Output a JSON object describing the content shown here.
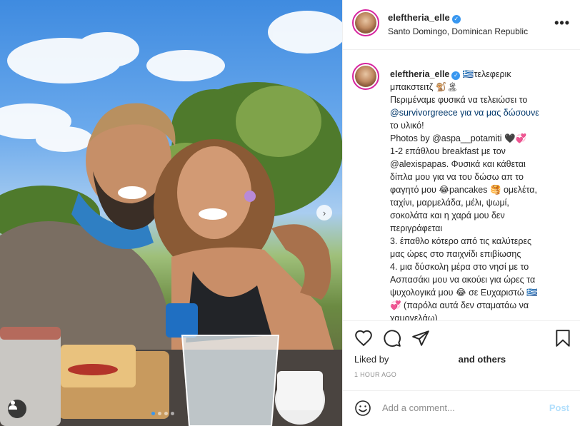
{
  "post": {
    "username": "eleftheria_elle",
    "location": "Santo Domingo, Dominican Republic",
    "more_label": "•••"
  },
  "caption": {
    "username": "eleftheria_elle",
    "lines": [
      "🇬🇷τελεφερικ",
      "μπακστειτζ 🐒🏝",
      "Περιμέναμε φυσικά να τελειώσει το",
      "@survivorgreece για να μας δώσουνε",
      "το υλικό!",
      "Photos by @aspa__potamiti 🖤💞",
      "1-2 επάθλου breakfast με τον",
      "@alexispapas. Φυσικά και κάθεται",
      "δίπλα μου για να του δώσω απ το",
      "φαγητό μου 😂pancakes 🥞 ομελέτα,",
      "ταχίνι, μαρμελάδα, μέλι, ψωμί,",
      "σοκολάτα και η χαρά μου δεν",
      "περιγράφεται",
      "3. έπαθλο κότερο από τις καλύτερες",
      "μας ώρες στο παιχνίδι επιβίωσης",
      "4. μια δύσκολη μέρα στο νησί με το",
      "Ασπασάκι μου να ακούει για ώρες τα",
      "ψυχολογικά μου 😂 σε Ευχαριστώ 🇬🇷",
      "💞 (παρόλα αυτά δεν σταματάω να",
      "χαμογελάω)"
    ]
  },
  "likes": {
    "prefix": "Liked by",
    "suffix": "and others"
  },
  "timestamp": "1 HOUR AGO",
  "comment": {
    "placeholder": "Add a comment...",
    "post_label": "Post"
  },
  "icons": {
    "like": "heart-icon",
    "comment": "comment-icon",
    "share": "share-icon",
    "save": "bookmark-icon",
    "emoji": "emoji-icon",
    "carousel_next": "chevron-right-icon",
    "tag": "user-tag-icon"
  },
  "colors": {
    "accent": "#3897f0",
    "mention": "#00376b",
    "post_disabled": "#b2dffc",
    "muted": "#8e8e8e"
  },
  "carousel": {
    "slide_count": 4,
    "active_index": 0
  }
}
